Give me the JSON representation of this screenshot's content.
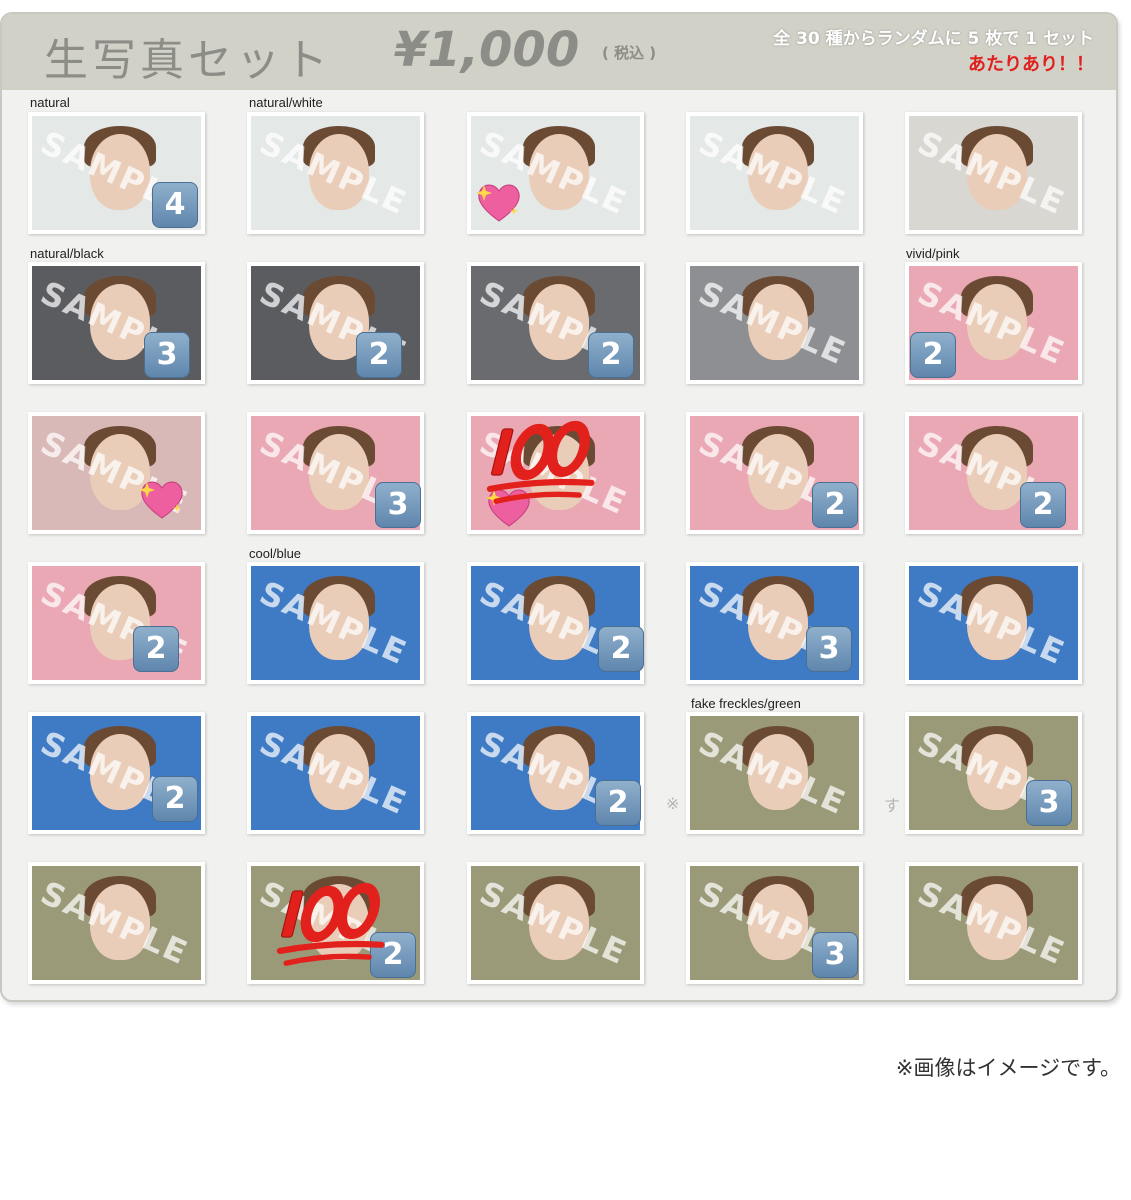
{
  "header": {
    "title": "生写真セット",
    "price": "¥1,000",
    "tax": "( 税込 )",
    "note_line1": "全 30 種からランダムに 5 枚で 1 セット",
    "note_line2": "あたりあり！！"
  },
  "labels": {
    "natural": "natural",
    "natural_white": "natural/white",
    "natural_black": "natural/black",
    "vivid_pink": "vivid/pink",
    "cool_blue": "cool/blue",
    "fake_freckles_green": "fake freckles/green"
  },
  "watermark": "SAMPLE",
  "badges": {
    "b4": "4",
    "b3": "3",
    "b2": "2"
  },
  "ghost_text": {
    "left": "※",
    "right": "す"
  },
  "footer": {
    "note": "※画像はイメージです。"
  },
  "colors": {
    "pale": "#e4e8e6",
    "black": "#5b5c60",
    "gray": "#8e8f92",
    "pink": "#e9a8b3",
    "blue": "#3e7bc4",
    "green": "#9a9a78",
    "badge": "#6f94bb",
    "accent_red": "#e0201e"
  }
}
